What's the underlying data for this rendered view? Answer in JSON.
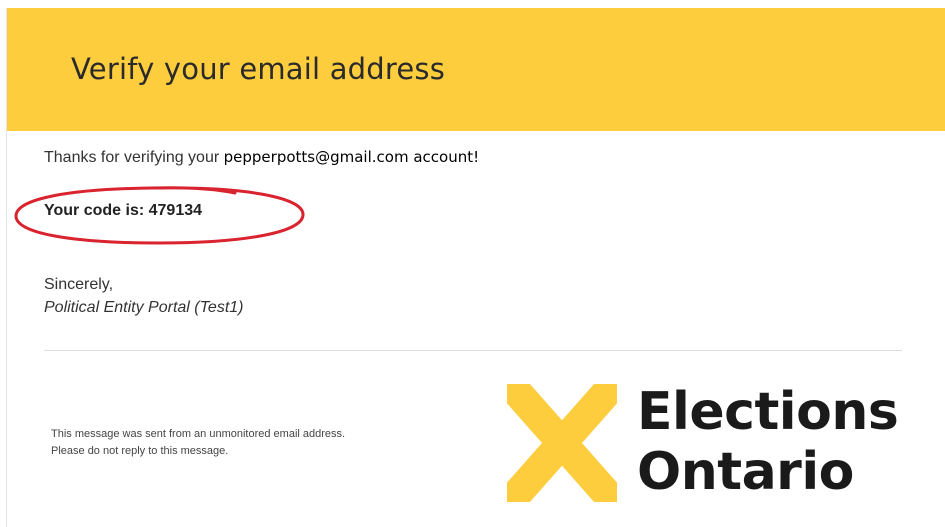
{
  "header": {
    "title": "Verify your email address",
    "banner_color": "#fdcd3e"
  },
  "body": {
    "thanks_prefix": "Thanks for verifying your",
    "email_address": "pepperpotts@gmail.com",
    "thanks_suffix": "account!",
    "code_label": "Your code is:",
    "code_value": "479134",
    "highlight_color": "#d9232e",
    "closing": "Sincerely,",
    "signature": "Political Entity Portal (Test1)"
  },
  "footer": {
    "note_line1": "This message was sent from an unmonitored email address.",
    "note_line2": "Please do not reply to this message."
  },
  "logo": {
    "line1": "Elections",
    "line2": "Ontario",
    "mark_color": "#fdcd3e",
    "mark_icon": "x-mark-icon"
  }
}
